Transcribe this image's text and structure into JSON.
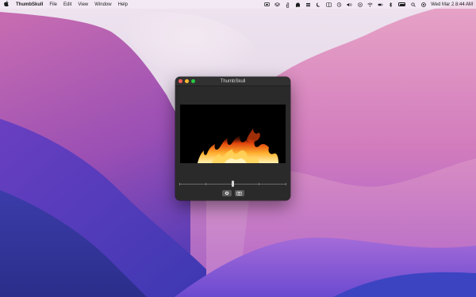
{
  "menubar": {
    "apple_glyph": "",
    "app_name": "ThumbSkull",
    "menus": [
      "File",
      "Edit",
      "View",
      "Window",
      "Help"
    ],
    "clock": "Wed Mar 2  8:44 AM"
  },
  "window": {
    "title": "ThumbSkull"
  },
  "slider": {
    "value_fraction": 0.5
  }
}
